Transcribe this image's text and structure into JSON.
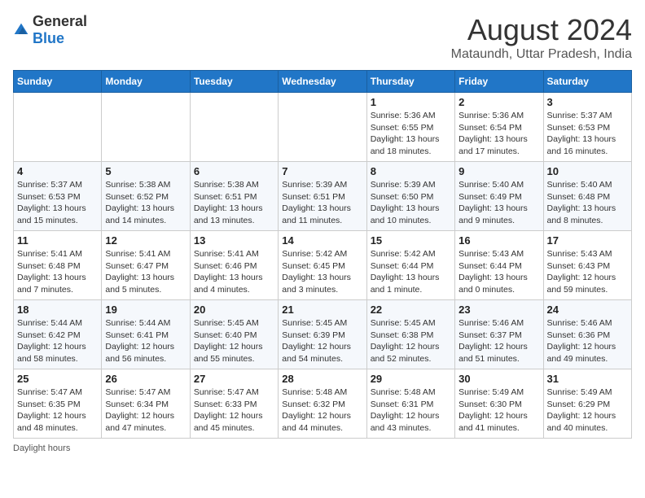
{
  "header": {
    "logo_general": "General",
    "logo_blue": "Blue",
    "month_year": "August 2024",
    "location": "Mataundh, Uttar Pradesh, India"
  },
  "weekdays": [
    "Sunday",
    "Monday",
    "Tuesday",
    "Wednesday",
    "Thursday",
    "Friday",
    "Saturday"
  ],
  "weeks": [
    [
      {
        "day": "",
        "info": ""
      },
      {
        "day": "",
        "info": ""
      },
      {
        "day": "",
        "info": ""
      },
      {
        "day": "",
        "info": ""
      },
      {
        "day": "1",
        "info": "Sunrise: 5:36 AM\nSunset: 6:55 PM\nDaylight: 13 hours\nand 18 minutes."
      },
      {
        "day": "2",
        "info": "Sunrise: 5:36 AM\nSunset: 6:54 PM\nDaylight: 13 hours\nand 17 minutes."
      },
      {
        "day": "3",
        "info": "Sunrise: 5:37 AM\nSunset: 6:53 PM\nDaylight: 13 hours\nand 16 minutes."
      }
    ],
    [
      {
        "day": "4",
        "info": "Sunrise: 5:37 AM\nSunset: 6:53 PM\nDaylight: 13 hours\nand 15 minutes."
      },
      {
        "day": "5",
        "info": "Sunrise: 5:38 AM\nSunset: 6:52 PM\nDaylight: 13 hours\nand 14 minutes."
      },
      {
        "day": "6",
        "info": "Sunrise: 5:38 AM\nSunset: 6:51 PM\nDaylight: 13 hours\nand 13 minutes."
      },
      {
        "day": "7",
        "info": "Sunrise: 5:39 AM\nSunset: 6:51 PM\nDaylight: 13 hours\nand 11 minutes."
      },
      {
        "day": "8",
        "info": "Sunrise: 5:39 AM\nSunset: 6:50 PM\nDaylight: 13 hours\nand 10 minutes."
      },
      {
        "day": "9",
        "info": "Sunrise: 5:40 AM\nSunset: 6:49 PM\nDaylight: 13 hours\nand 9 minutes."
      },
      {
        "day": "10",
        "info": "Sunrise: 5:40 AM\nSunset: 6:48 PM\nDaylight: 13 hours\nand 8 minutes."
      }
    ],
    [
      {
        "day": "11",
        "info": "Sunrise: 5:41 AM\nSunset: 6:48 PM\nDaylight: 13 hours\nand 7 minutes."
      },
      {
        "day": "12",
        "info": "Sunrise: 5:41 AM\nSunset: 6:47 PM\nDaylight: 13 hours\nand 5 minutes."
      },
      {
        "day": "13",
        "info": "Sunrise: 5:41 AM\nSunset: 6:46 PM\nDaylight: 13 hours\nand 4 minutes."
      },
      {
        "day": "14",
        "info": "Sunrise: 5:42 AM\nSunset: 6:45 PM\nDaylight: 13 hours\nand 3 minutes."
      },
      {
        "day": "15",
        "info": "Sunrise: 5:42 AM\nSunset: 6:44 PM\nDaylight: 13 hours\nand 1 minute."
      },
      {
        "day": "16",
        "info": "Sunrise: 5:43 AM\nSunset: 6:44 PM\nDaylight: 13 hours\nand 0 minutes."
      },
      {
        "day": "17",
        "info": "Sunrise: 5:43 AM\nSunset: 6:43 PM\nDaylight: 12 hours\nand 59 minutes."
      }
    ],
    [
      {
        "day": "18",
        "info": "Sunrise: 5:44 AM\nSunset: 6:42 PM\nDaylight: 12 hours\nand 58 minutes."
      },
      {
        "day": "19",
        "info": "Sunrise: 5:44 AM\nSunset: 6:41 PM\nDaylight: 12 hours\nand 56 minutes."
      },
      {
        "day": "20",
        "info": "Sunrise: 5:45 AM\nSunset: 6:40 PM\nDaylight: 12 hours\nand 55 minutes."
      },
      {
        "day": "21",
        "info": "Sunrise: 5:45 AM\nSunset: 6:39 PM\nDaylight: 12 hours\nand 54 minutes."
      },
      {
        "day": "22",
        "info": "Sunrise: 5:45 AM\nSunset: 6:38 PM\nDaylight: 12 hours\nand 52 minutes."
      },
      {
        "day": "23",
        "info": "Sunrise: 5:46 AM\nSunset: 6:37 PM\nDaylight: 12 hours\nand 51 minutes."
      },
      {
        "day": "24",
        "info": "Sunrise: 5:46 AM\nSunset: 6:36 PM\nDaylight: 12 hours\nand 49 minutes."
      }
    ],
    [
      {
        "day": "25",
        "info": "Sunrise: 5:47 AM\nSunset: 6:35 PM\nDaylight: 12 hours\nand 48 minutes."
      },
      {
        "day": "26",
        "info": "Sunrise: 5:47 AM\nSunset: 6:34 PM\nDaylight: 12 hours\nand 47 minutes."
      },
      {
        "day": "27",
        "info": "Sunrise: 5:47 AM\nSunset: 6:33 PM\nDaylight: 12 hours\nand 45 minutes."
      },
      {
        "day": "28",
        "info": "Sunrise: 5:48 AM\nSunset: 6:32 PM\nDaylight: 12 hours\nand 44 minutes."
      },
      {
        "day": "29",
        "info": "Sunrise: 5:48 AM\nSunset: 6:31 PM\nDaylight: 12 hours\nand 43 minutes."
      },
      {
        "day": "30",
        "info": "Sunrise: 5:49 AM\nSunset: 6:30 PM\nDaylight: 12 hours\nand 41 minutes."
      },
      {
        "day": "31",
        "info": "Sunrise: 5:49 AM\nSunset: 6:29 PM\nDaylight: 12 hours\nand 40 minutes."
      }
    ]
  ],
  "footer": {
    "daylight_label": "Daylight hours"
  }
}
